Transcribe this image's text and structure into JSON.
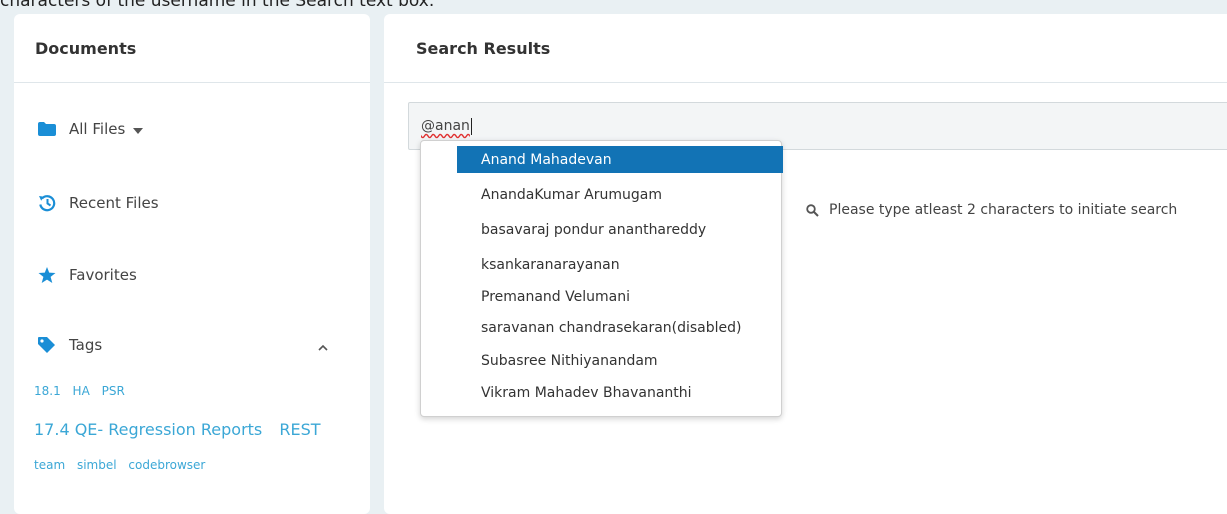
{
  "instruction_text": "characters of the username in the Search text box.",
  "left_panel": {
    "title": "Documents",
    "items": [
      {
        "label": "All Files",
        "icon": "folder-icon"
      },
      {
        "label": "Recent Files",
        "icon": "history-icon"
      },
      {
        "label": "Favorites",
        "icon": "star-icon"
      },
      {
        "label": "Tags",
        "icon": "tag-icon"
      }
    ],
    "tags": {
      "row1": [
        "18.1",
        "HA",
        "PSR"
      ],
      "row2": [
        "17.4 QE- Regression Reports",
        "REST"
      ],
      "row3": [
        "team",
        "simbel",
        "codebrowser"
      ]
    }
  },
  "right_panel": {
    "title": "Search Results",
    "search": {
      "value": "@anan"
    },
    "hint": "Please type atleast 2 characters to initiate search"
  },
  "suggestions": [
    "Anand Mahadevan",
    "AnandaKumar Arumugam",
    "basavaraj pondur ananthareddy",
    "ksankaranarayanan",
    "Premanand Velumani",
    "saravanan chandrasekaran(disabled)",
    "Subasree Nithiyanandam",
    "Vikram Mahadev Bhavananthi"
  ],
  "colors": {
    "accent": "#1273b5",
    "tag_link": "#3ba7d6",
    "icon": "#1a8ed6"
  }
}
